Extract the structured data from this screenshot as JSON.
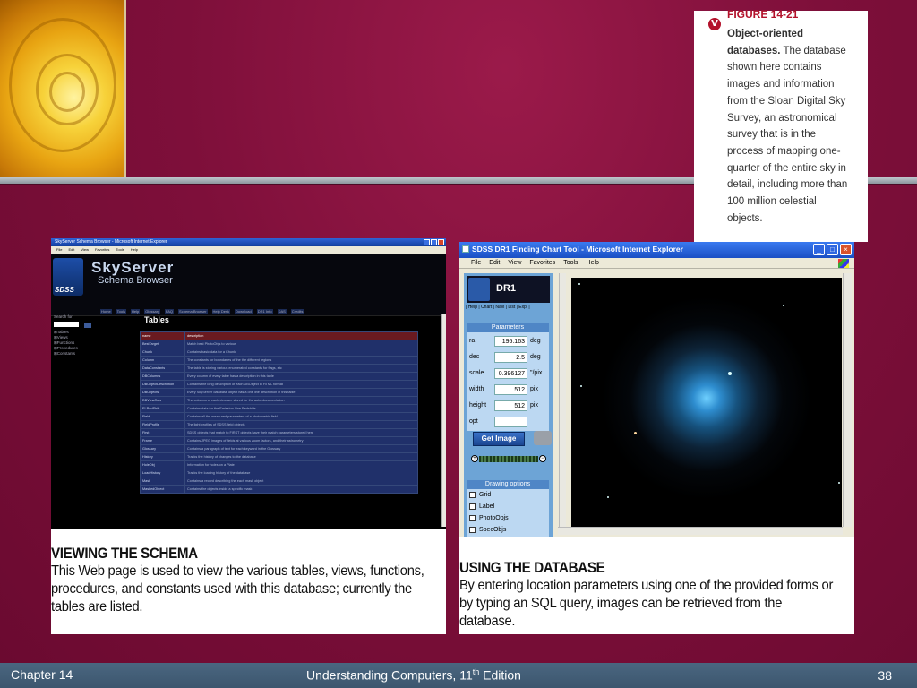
{
  "figure": {
    "number": "FIGURE 14-21",
    "title": "Object-oriented databases.",
    "body": "The database shown here contains images and information from the Sloan Digital Sky Survey, an astronomical survey that is in the process of mapping one-quarter of the entire sky in detail, including more than 100 million celestial objects."
  },
  "screen1": {
    "window_title": "SkyServer Schema Browser - Microsoft Internet Explorer",
    "menu": [
      "File",
      "Edit",
      "View",
      "Favorites",
      "Tools",
      "Help"
    ],
    "site_title": "SkyServer",
    "site_subtitle": "Schema Browser",
    "nav": [
      "Home",
      "Tools",
      "Help",
      "Glossary",
      "FAQ",
      "Schema Browser",
      "Help Desk",
      "Download",
      "DR1 Info",
      "DAS",
      "Credits"
    ],
    "search_label": "Search for",
    "side_items": [
      "Tables",
      "Views",
      "Functions",
      "Procedures",
      "Constants"
    ],
    "tables_heading": "Tables",
    "table_headers": [
      "name",
      "description"
    ],
    "table_rows": [
      [
        "BestTarget",
        "Match best PhotoObjs to various"
      ],
      [
        "Chunk",
        "Contains basic data for a Chunk"
      ],
      [
        "Column",
        "The constants for boundaries of the the different regions"
      ],
      [
        "DataConstants",
        "The table is storing various enumerated constants for flags, etc"
      ],
      [
        "DBColumns",
        "Every column of every table has a description in this table"
      ],
      [
        "DBObjectDescription",
        "Contains the long description of each DBObject in HTML format"
      ],
      [
        "DBObjects",
        "Every SkyServer database object has a one line description in this table"
      ],
      [
        "DBViewCols",
        "The columns of each view are stored for the auto-documentation"
      ],
      [
        "ELRedShift",
        "Contains data for the Emission Line Redshifts"
      ],
      [
        "Field",
        "Contains all the measured parameters of a photometric field"
      ],
      [
        "FieldProfile",
        "The light profiles of SDSS field objects"
      ],
      [
        "First",
        "SDSS objects that match to FIRST objects have their match parameters stored here"
      ],
      [
        "Frame",
        "Contains JPEG images of fields at various zoom factors, and their astrometry"
      ],
      [
        "Glossary",
        "Contains a paragraph of text for each keyword in the Glossary"
      ],
      [
        "History",
        "Tracks the history of changes to the database"
      ],
      [
        "HoleObj",
        "Information for holes on a Plate"
      ],
      [
        "LoadHistory",
        "Tracks the loading history of the database"
      ],
      [
        "Mask",
        "Contains a record describing the each mask object"
      ],
      [
        "MaskedObject",
        "Contains the objects inside a specific mask"
      ]
    ],
    "caption_heading": "VIEWING THE SCHEMA",
    "caption_body": "This Web page is used to view the various tables, views, functions, procedures, and constants used with this database; currently the tables are listed."
  },
  "screen2": {
    "window_title": "SDSS DR1 Finding Chart Tool - Microsoft Internet Explorer",
    "menu": [
      "File",
      "Edit",
      "View",
      "Favorites",
      "Tools",
      "Help"
    ],
    "panel_title": "DR1",
    "panel_links": "| Help | Chart | Navi | List | Expl |",
    "params_heading": "Parameters",
    "params": [
      {
        "label": "ra",
        "value": "195.163",
        "unit": "deg"
      },
      {
        "label": "dec",
        "value": "2.5",
        "unit": "deg"
      },
      {
        "label": "scale",
        "value": "0.396127",
        "unit": "\"/pix"
      },
      {
        "label": "width",
        "value": "512",
        "unit": "pix"
      },
      {
        "label": "height",
        "value": "512",
        "unit": "pix"
      },
      {
        "label": "opt",
        "value": "",
        "unit": ""
      }
    ],
    "get_image_label": "Get Image",
    "drawing_heading": "Drawing options",
    "drawing_options": [
      "Grid",
      "Label",
      "PhotoObjs",
      "SpecObjs"
    ],
    "caption_heading": "USING THE DATABASE",
    "caption_body": "By entering location parameters using one of the provided forms or by typing an SQL query, images can be retrieved from the database."
  },
  "footer": {
    "chapter": "Chapter 14",
    "book": "Understanding Computers, 11",
    "book_sup": "th",
    "book_suffix": " Edition",
    "page": "38"
  }
}
